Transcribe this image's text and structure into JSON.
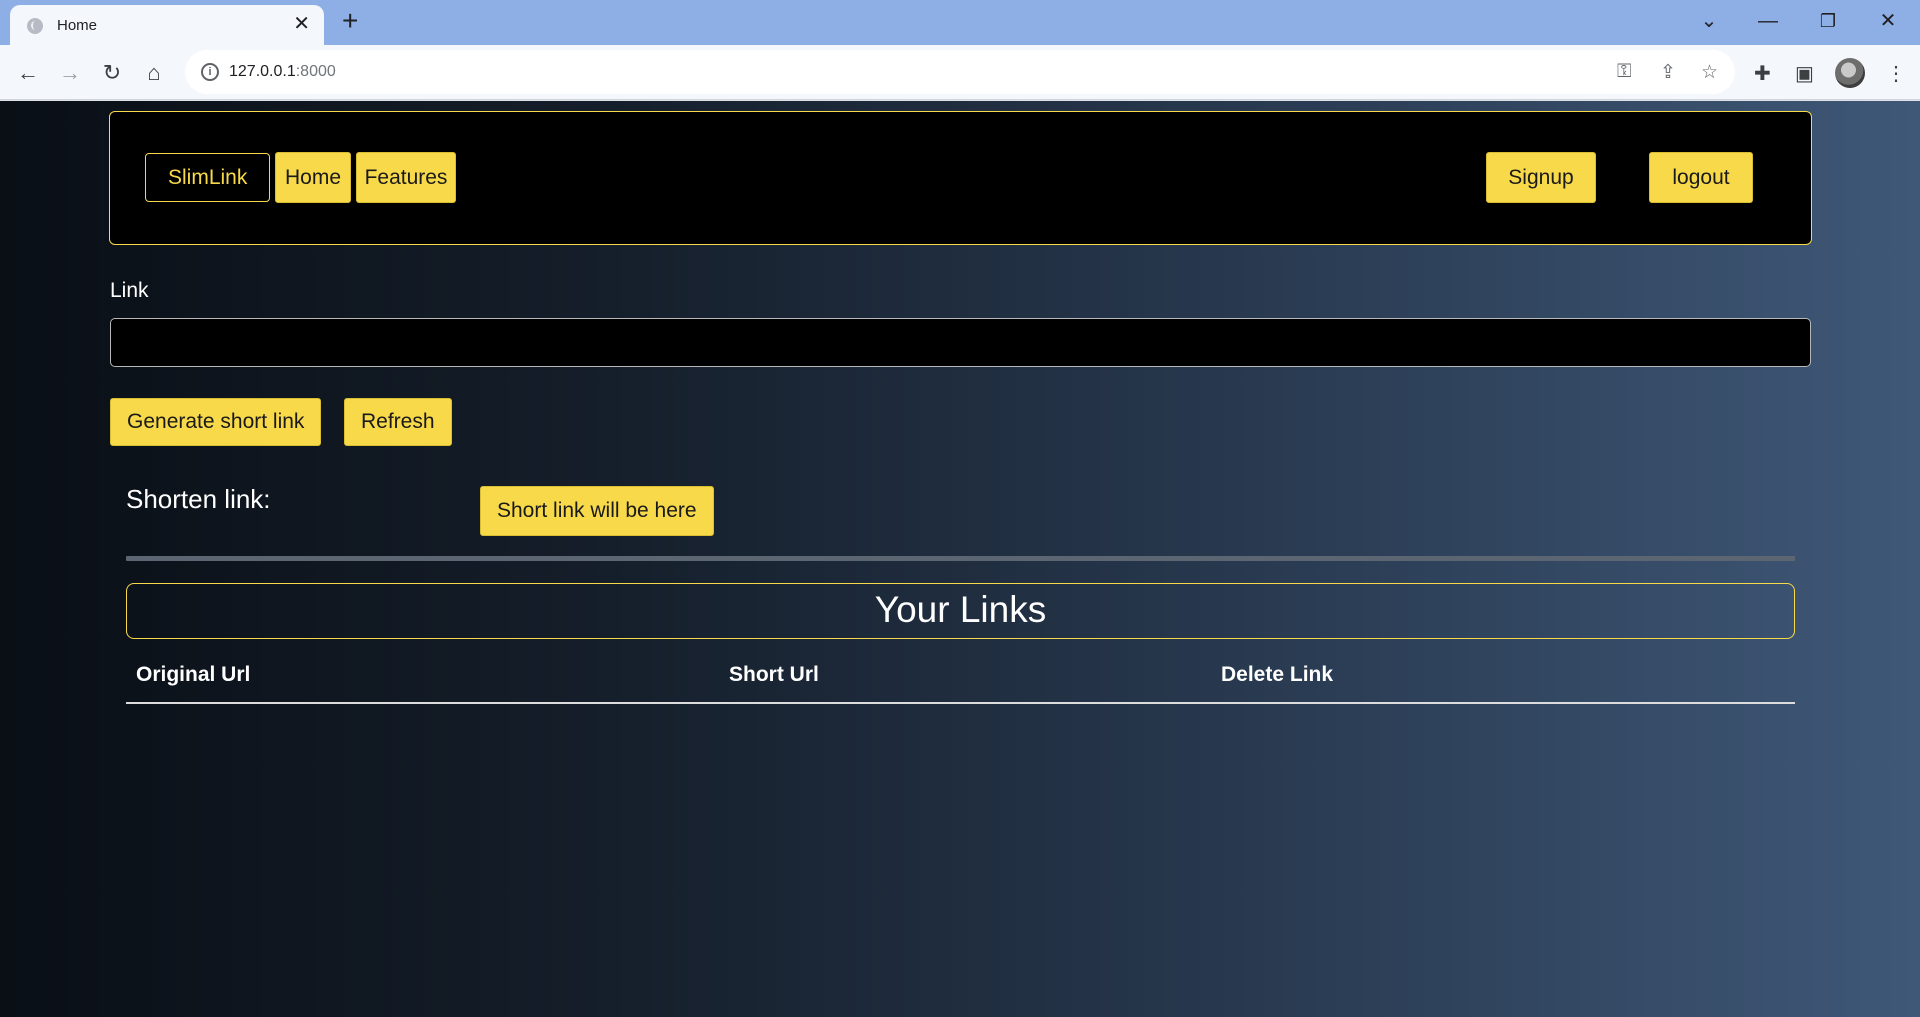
{
  "browser": {
    "tab_title": "Home",
    "tab_close": "✕",
    "new_tab": "+",
    "url_host": "127.0.0.1",
    "url_port": ":8000",
    "icons": [
      "globe-icon",
      "back-icon",
      "forward-icon",
      "reload-icon",
      "home-icon",
      "info-icon",
      "key-icon",
      "share-icon",
      "star-icon",
      "extensions-icon",
      "side-panel-icon",
      "menu-icon"
    ]
  },
  "navbar": {
    "brand": "SlimLink",
    "links": [
      "Home",
      "Features"
    ],
    "signup": "Signup",
    "logout": "logout"
  },
  "form": {
    "link_label": "Link",
    "link_value": "",
    "generate_button": "Generate short link",
    "refresh_button": "Refresh"
  },
  "result": {
    "label": "Shorten link:",
    "placeholder": "Short link will be here"
  },
  "links_table": {
    "title": "Your Links",
    "columns": [
      "Original Url",
      "Short Url",
      "Delete Link"
    ],
    "rows": []
  },
  "colors": {
    "accent": "#f8d94a",
    "nav_background": "#000000"
  }
}
